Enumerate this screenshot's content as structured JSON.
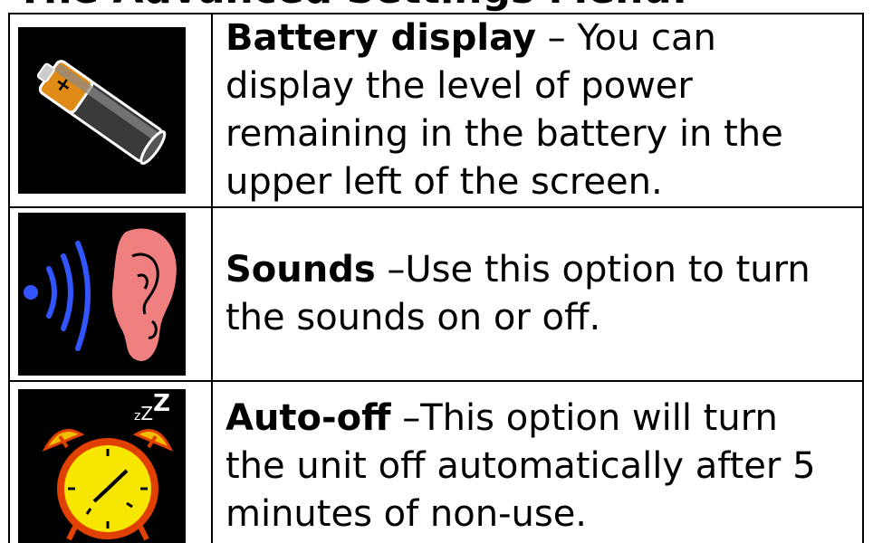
{
  "title": "The Advanced Settings Menu:",
  "rows": [
    {
      "icon": "battery-icon",
      "heading": "Battery display",
      "separator": " – ",
      "line1_rest": "You can",
      "line2": "display the level of power",
      "line3": "remaining in the battery in the",
      "line4": "upper left of the screen."
    },
    {
      "icon": "ear-sound-icon",
      "heading": "Sounds",
      "separator": " –",
      "line1_rest": "Use this option to turn",
      "line2": "the sounds on or off."
    },
    {
      "icon": "alarm-clock-icon",
      "heading": "Auto-off",
      "separator": " –",
      "line1_rest": "This option will turn",
      "line2": "the unit off automatically after 5",
      "line3": "minutes of non-use.",
      "icon_text": "zZZ"
    }
  ]
}
